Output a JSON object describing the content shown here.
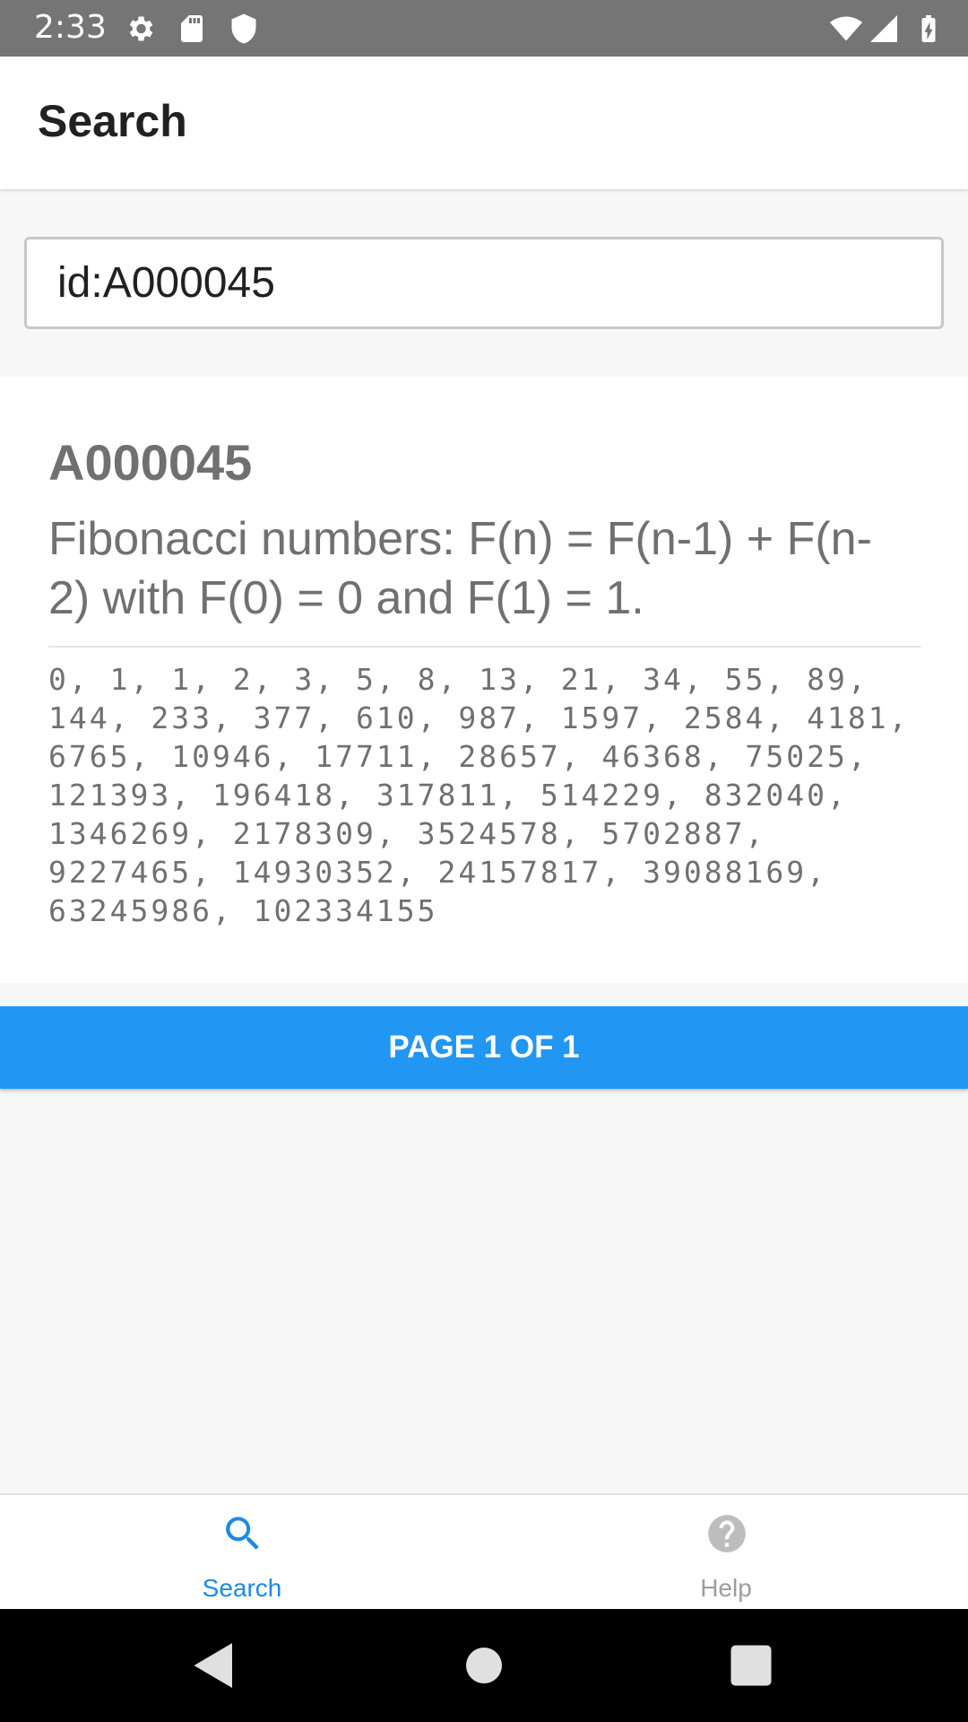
{
  "status_bar": {
    "time": "2:33",
    "icons": [
      "settings-gear-icon",
      "sd-card-icon",
      "shield-icon",
      "wifi-icon",
      "signal-icon",
      "battery-charging-icon"
    ]
  },
  "app_bar": {
    "title": "Search"
  },
  "search": {
    "value": "id:A000045"
  },
  "result": {
    "id": "A000045",
    "name": "Fibonacci numbers: F(n) = F(n-1) + F(n-2) with F(0) = 0 and F(1) = 1.",
    "sequence": "0, 1, 1, 2, 3, 5, 8, 13, 21, 34, 55, 89, 144, 233, 377, 610, 987, 1597, 2584, 4181, 6765, 10946, 17711, 28657, 46368, 75025, 121393, 196418, 317811, 514229, 832040, 1346269, 2178309, 3524578, 5702887, 9227465, 14930352, 24157817, 39088169, 63245986, 102334155"
  },
  "pagination": {
    "label": "PAGE 1 OF 1"
  },
  "bottom_nav": {
    "items": [
      {
        "label": "Search",
        "icon": "search-icon",
        "active": true
      },
      {
        "label": "Help",
        "icon": "help-icon",
        "active": false
      }
    ]
  },
  "colors": {
    "accent": "#2196f3",
    "active_nav": "#1e88e5",
    "status_bar": "#757575",
    "text_secondary": "#707070"
  }
}
